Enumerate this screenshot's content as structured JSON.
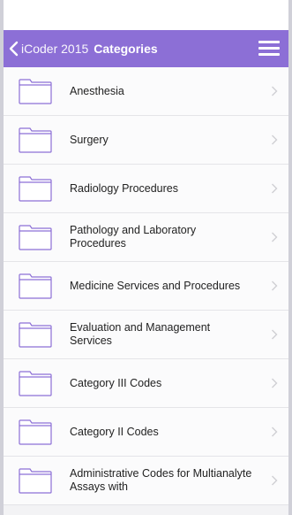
{
  "navbar": {
    "back_label": "iCoder 2015",
    "title": "Categories",
    "accent_color": "#8c6fd6",
    "back_icon": "chevron-left-icon",
    "menu_icon": "hamburger-menu-icon"
  },
  "categories": [
    {
      "label": "Anesthesia"
    },
    {
      "label": "Surgery"
    },
    {
      "label": "Radiology Procedures"
    },
    {
      "label": "Pathology and Laboratory Procedures"
    },
    {
      "label": "Medicine Services and Procedures"
    },
    {
      "label": "Evaluation and Management Services"
    },
    {
      "label": "Category III Codes"
    },
    {
      "label": "Category II Codes"
    },
    {
      "label": "Administrative Codes for Multianalyte Assays with"
    }
  ],
  "row_icon": "folder-icon",
  "row_indicator_icon": "chevron-right-icon"
}
